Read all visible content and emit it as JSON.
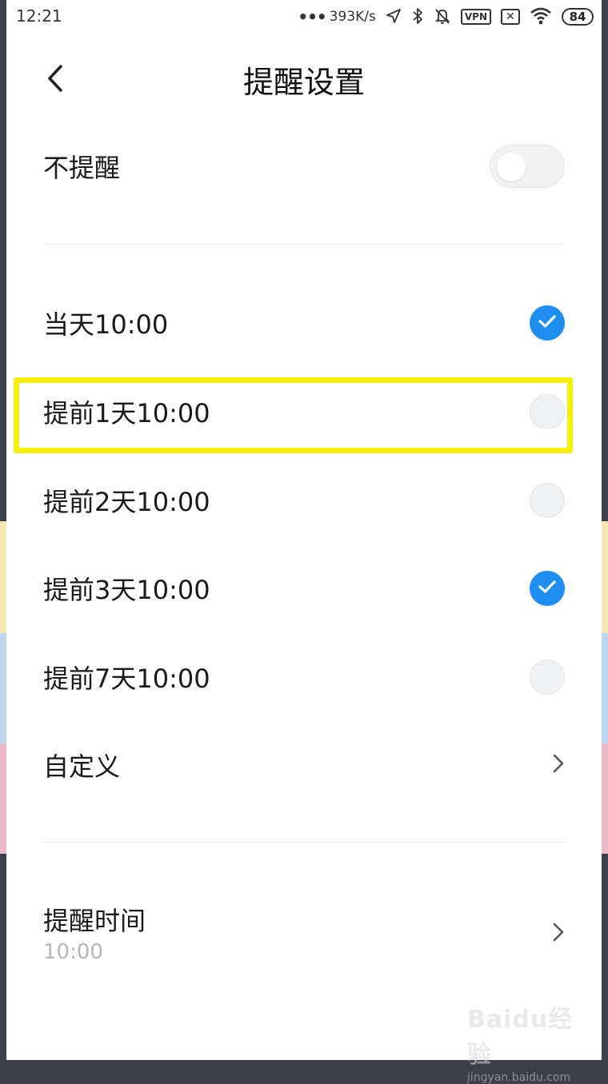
{
  "status_bar": {
    "time": "12:21",
    "network_speed": "393K/s",
    "vpn_label": "VPN",
    "battery": "84"
  },
  "header": {
    "title": "提醒设置"
  },
  "no_remind": {
    "label": "不提醒",
    "enabled": false
  },
  "options": [
    {
      "label": "当天10:00",
      "selected": true
    },
    {
      "label": "提前1天10:00",
      "selected": false
    },
    {
      "label": "提前2天10:00",
      "selected": false
    },
    {
      "label": "提前3天10:00",
      "selected": true
    },
    {
      "label": "提前7天10:00",
      "selected": false
    }
  ],
  "custom": {
    "label": "自定义"
  },
  "remind_time": {
    "label": "提醒时间",
    "value": "10:00"
  },
  "watermark": {
    "brand": "Baidu经验",
    "url": "jingyan.baidu.com"
  },
  "colors": {
    "accent": "#1e8ff0",
    "highlight": "#f7f000",
    "edge_yellow": "#f7e7b6",
    "edge_blue": "#bcd6ee",
    "edge_pink": "#ecb9c8"
  },
  "icons": {
    "back": "chevron-left-icon",
    "check": "check-icon",
    "arrow": "chevron-right-icon"
  }
}
